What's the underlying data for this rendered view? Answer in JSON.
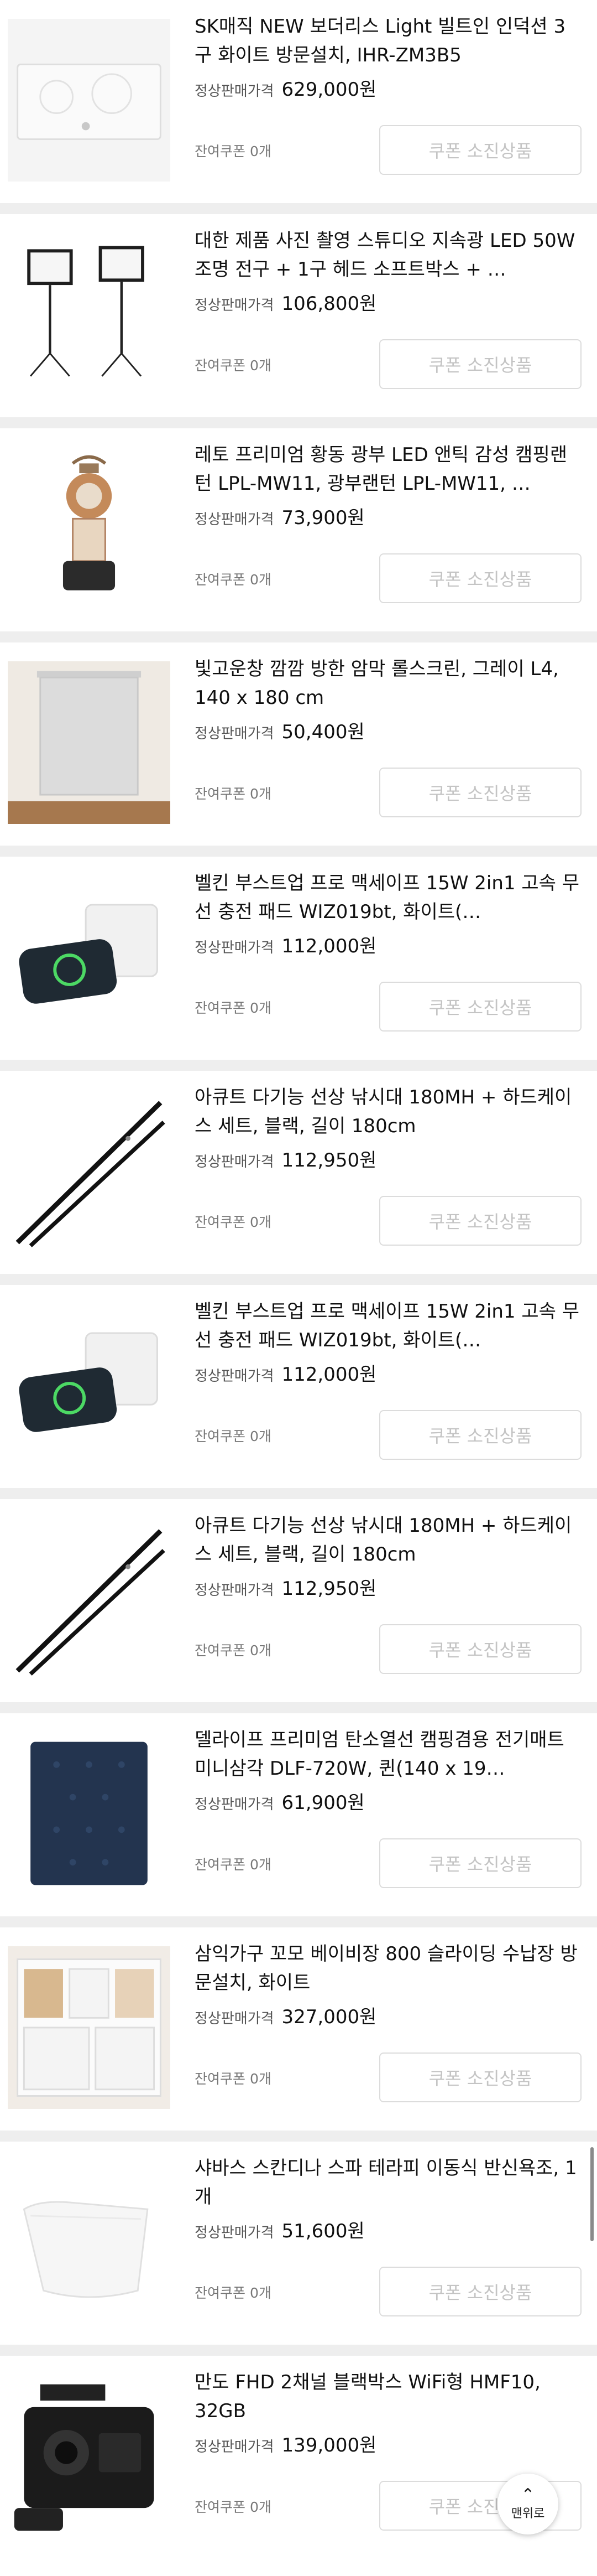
{
  "price_label": "정상판매가격",
  "coupon_left": "잔여쿠폰 0개",
  "coupon_button": "쿠폰 소진상품",
  "scroll_top": {
    "label": "맨위로",
    "icon": "chevron-up-icon"
  },
  "items": [
    {
      "title": "SK매직 NEW 보더리스 Light 빌트인 인덕션 3구 화이트 방문설치, IHR-ZM3B5",
      "price": "629,000원",
      "thumb": "induction-cooktop"
    },
    {
      "title": "대한 제품 사진 촬영 스튜디오 지속광 LED 50W 조명 전구 + 1구 헤드 소프트박스 + …",
      "price": "106,800원",
      "thumb": "softbox-lights"
    },
    {
      "title": "레토 프리미엄 황동 광부 LED 앤틱 감성 캠핑랜턴 LPL-MW11, 광부랜턴 LPL-MW11, …",
      "price": "73,900원",
      "thumb": "camping-lantern"
    },
    {
      "title": "빛고운창 깜깜 방한 암막 롤스크린, 그레이 L4, 140 x 180 cm",
      "price": "50,400원",
      "thumb": "roll-screen"
    },
    {
      "title": "벨킨 부스트업 프로 맥세이프 15W 2in1 고속 무선 충전 패드 WIZ019bt, 화이트(…",
      "price": "112,000원",
      "thumb": "wireless-charger"
    },
    {
      "title": "아큐트 다기능 선상 낚시대 180MH + 하드케이스 세트, 블랙, 길이 180cm",
      "price": "112,950원",
      "thumb": "fishing-rod"
    },
    {
      "title": "벨킨 부스트업 프로 맥세이프 15W 2in1 고속 무선 충전 패드 WIZ019bt, 화이트(…",
      "price": "112,000원",
      "thumb": "wireless-charger"
    },
    {
      "title": "아큐트 다기능 선상 낚시대 180MH + 하드케이스 세트, 블랙, 길이 180cm",
      "price": "112,950원",
      "thumb": "fishing-rod"
    },
    {
      "title": "델라이프 프리미엄 탄소열선 캠핑겸용 전기매트 미니삼각 DLF-720W, 퀸(140 x 19…",
      "price": "61,900원",
      "thumb": "electric-mat"
    },
    {
      "title": "삼익가구 꼬모 베이비장 800 슬라이딩 수납장 방문설치, 화이트",
      "price": "327,000원",
      "thumb": "storage-cabinet"
    },
    {
      "title": "샤바스 스칸디나 스파 테라피 이동식 반신욕조, 1개",
      "price": "51,600원",
      "thumb": "bathtub"
    },
    {
      "title": "만도 FHD 2채널 블랙박스 WiFi형 HMF10, 32GB",
      "price": "139,000원",
      "thumb": "dashcam"
    }
  ]
}
